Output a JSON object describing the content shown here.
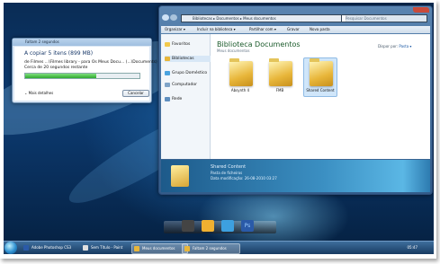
{
  "copy_dialog": {
    "title": "Faltam 2 segundos",
    "heading": "A copiar 5 itens (899 MB)",
    "from_line": "de Filmes ...\\Filmes library - para Os Meus Docu... (...\\Documents)",
    "remaining": "Cerca de 20 segundos restante",
    "progress": 0.62,
    "more_details": "Mais detalhes",
    "cancel": "Cancelar"
  },
  "explorer": {
    "address": "Bibliotecas ▸ Documentos ▸ Meus documentos",
    "search_placeholder": "Pesquisar Documentos",
    "toolbar": [
      "Organizar ▾",
      "Incluir na biblioteca ▾",
      "Partilhar com ▾",
      "Gravar",
      "Nova pasta"
    ],
    "nav": [
      "Favoritos",
      "Bibliotecas",
      "Grupo Doméstico",
      "Computador",
      "Rede"
    ],
    "library_title": "Biblioteca Documentos",
    "library_sub": "Meus documentos",
    "arrange_label": "Dispor por:",
    "arrange_value": "Pasta ▾",
    "folders": [
      "Absynth 4",
      "FMB",
      "Shared Content"
    ],
    "details": {
      "name": "Shared Content",
      "type": "Pasta de ficheiros",
      "modified_label": "Data modificação:",
      "modified_value": "26-08-2010 03:27"
    }
  },
  "taskbar": {
    "items": [
      "Adobe Photoshop CS3",
      "Sem Título - Paint",
      "Meus documentos",
      "Faltam 2 segundos"
    ],
    "clock": "05:47"
  },
  "colors": {
    "accent": "#3b8fc2",
    "folder": "#e8b63a",
    "progress": "#2fa82f"
  }
}
